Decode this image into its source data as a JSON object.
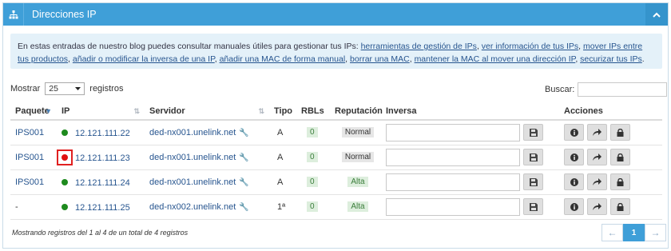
{
  "panel": {
    "title": "Direcciones IP"
  },
  "info": {
    "intro": "En estas entradas de nuestro blog puedes consultar manuales útiles para gestionar tus IPs: ",
    "links": [
      "herramientas de gestión de IPs",
      "ver información de tus IPs",
      "mover IPs entre tus productos",
      "añadir o modificar la inversa de una IP",
      "añadir una MAC de forma manual",
      "borrar una MAC",
      "mantener la MAC al mover una dirección IP",
      "securizar tus IPs"
    ],
    "separator": ", ",
    "end": "."
  },
  "controls": {
    "show_label": "Mostrar",
    "page_size": "25",
    "records_label": "registros",
    "search_label": "Buscar:",
    "search_value": ""
  },
  "table": {
    "headers": {
      "paquete": "Paquete",
      "ip": "IP",
      "servidor": "Servidor",
      "tipo": "Tipo",
      "rbls": "RBLs",
      "reputacion": "Reputación",
      "inversa": "Inversa",
      "acciones": "Acciones"
    },
    "rows": [
      {
        "paquete": "IPS001",
        "ip": "12.121.111.22",
        "status_color": "#1e8a1e",
        "servidor": "ded-nx001.unelink.net",
        "tipo": "A",
        "rbls": "0",
        "reputacion": "Normal",
        "rep_kind": "normal",
        "inversa": ""
      },
      {
        "paquete": "IPS001",
        "ip": "12.121.111.23",
        "status_color": "#e01010",
        "servidor": "ded-nx001.unelink.net",
        "tipo": "A",
        "rbls": "0",
        "reputacion": "Normal",
        "rep_kind": "normal",
        "inversa": ""
      },
      {
        "paquete": "IPS001",
        "ip": "12.121.111.24",
        "status_color": "#1e8a1e",
        "servidor": "ded-nx001.unelink.net",
        "tipo": "A",
        "rbls": "0",
        "reputacion": "Alta",
        "rep_kind": "alta",
        "inversa": ""
      },
      {
        "paquete": "-",
        "ip": "12.121.111.25",
        "status_color": "#1e8a1e",
        "servidor": "ded-nx002.unelink.net",
        "tipo": "1ª",
        "rbls": "0",
        "reputacion": "Alta",
        "rep_kind": "alta",
        "inversa": ""
      }
    ]
  },
  "footer": {
    "summary": "Mostrando registros del 1 al 4 de un total de 4 registros",
    "prev": "←",
    "page": "1",
    "next": "→"
  },
  "icons": {
    "header": "sitemap-icon",
    "collapse": "chevron-up-icon",
    "save": "floppy-disk-icon",
    "info": "info-icon",
    "move": "share-arrow-icon",
    "lock": "lock-icon",
    "wrench": "wrench-icon"
  },
  "colors": {
    "accent": "#3f9fd8",
    "link": "#27558f",
    "status_ok": "#1e8a1e",
    "status_error": "#e01010"
  }
}
